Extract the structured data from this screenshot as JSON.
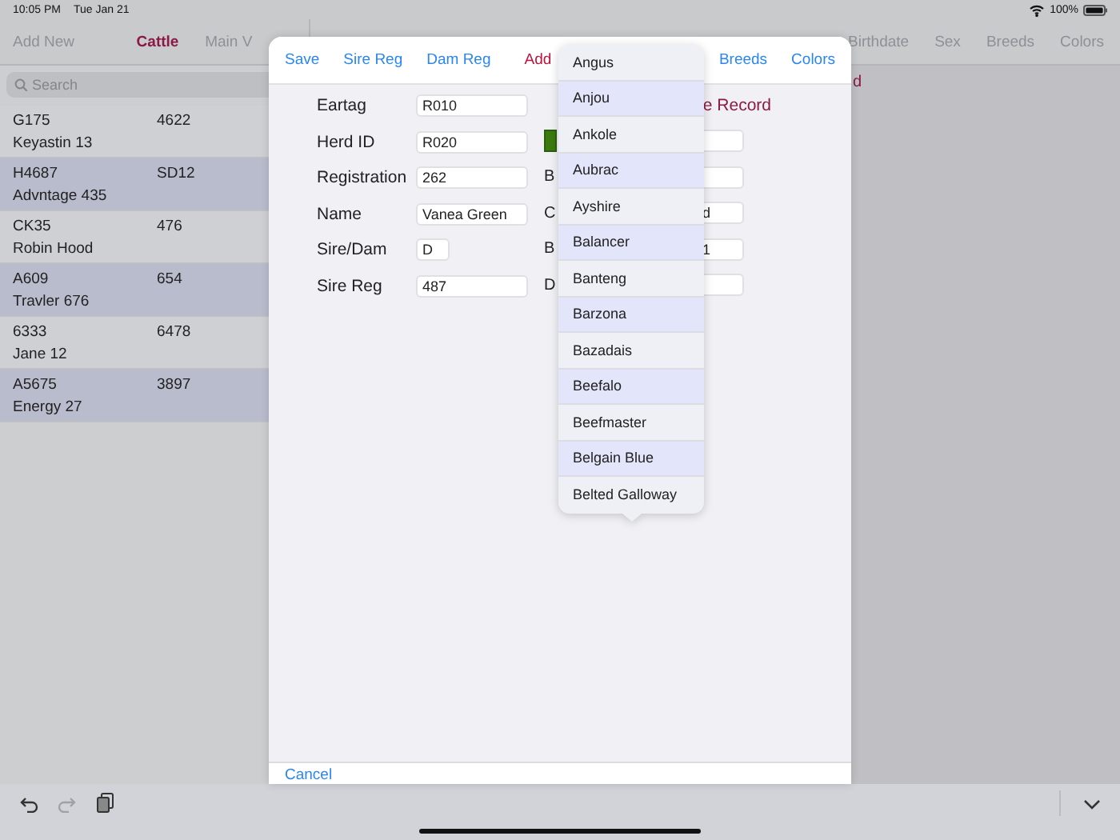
{
  "status_bar": {
    "time": "10:05 PM",
    "date": "Tue Jan 21",
    "battery": "100%"
  },
  "nav_bar": {
    "left_items": [
      {
        "label": "Add New",
        "kind": "action"
      },
      {
        "label": "Cattle",
        "kind": "title"
      },
      {
        "label": "Main V",
        "kind": "action"
      }
    ],
    "right_items": [
      "Birthdate",
      "Sex",
      "Breeds",
      "Colors"
    ]
  },
  "search": {
    "placeholder": "Search"
  },
  "cattle_list": [
    {
      "eartag": "G175",
      "column_2": "4622",
      "name": "Keyastin 13"
    },
    {
      "eartag": "H4687",
      "column_2": "SD12",
      "name": "Advntage 435"
    },
    {
      "eartag": "CK35",
      "column_2": "476",
      "name": "Robin Hood"
    },
    {
      "eartag": "A609",
      "column_2": "654",
      "name": "Travler 676"
    },
    {
      "eartag": "6333",
      "column_2": "6478",
      "name": "Jane 12"
    },
    {
      "eartag": "A5675",
      "column_2": "3897",
      "name": "Energy 27"
    }
  ],
  "detail_fragment": "d",
  "dialog": {
    "toolbar_left": [
      {
        "label": "Save",
        "kind": "link"
      },
      {
        "label": "Sire Reg",
        "kind": "link"
      },
      {
        "label": "Dam Reg",
        "kind": "link"
      },
      {
        "label": "Add",
        "kind": "accent"
      }
    ],
    "toolbar_right": [
      {
        "label": "Breeds",
        "kind": "link"
      },
      {
        "label": "Colors",
        "kind": "link"
      }
    ],
    "fields": [
      {
        "label": "Eartag",
        "value": "R010",
        "kind": "wide"
      },
      {
        "label": "Herd ID",
        "value": "R020",
        "kind": "wide"
      },
      {
        "label": "Registration",
        "value": "262",
        "kind": "wide"
      },
      {
        "label": "Name",
        "value": "Vanea Green",
        "kind": "wide"
      },
      {
        "label": "Sire/Dam",
        "value": "D",
        "kind": "short"
      },
      {
        "label": "Sire Reg",
        "value": "487",
        "kind": "wide"
      }
    ],
    "record_title": "e Record",
    "right_rows": [
      {
        "kind": "button"
      },
      {
        "kind": "field",
        "label": "B"
      },
      {
        "kind": "field",
        "label": "C",
        "value": "d"
      },
      {
        "kind": "field",
        "label": "B",
        "value": "1"
      },
      {
        "kind": "field",
        "label": "D"
      }
    ],
    "cancel": "Cancel"
  },
  "breed_picker": {
    "items": [
      "Angus",
      "Anjou",
      "Ankole",
      "Aubrac",
      "Ayshire",
      "Balancer",
      "Banteng",
      "Barzona",
      "Bazadais",
      "Beefalo",
      "Beefmaster",
      "Belgain Blue",
      "Belted Galloway"
    ]
  },
  "keyboard_toolbar": {
    "buttons": [
      {
        "kind": "undo",
        "disabled": false
      },
      {
        "kind": "redo",
        "disabled": true
      },
      {
        "kind": "paste",
        "disabled": false
      }
    ]
  }
}
